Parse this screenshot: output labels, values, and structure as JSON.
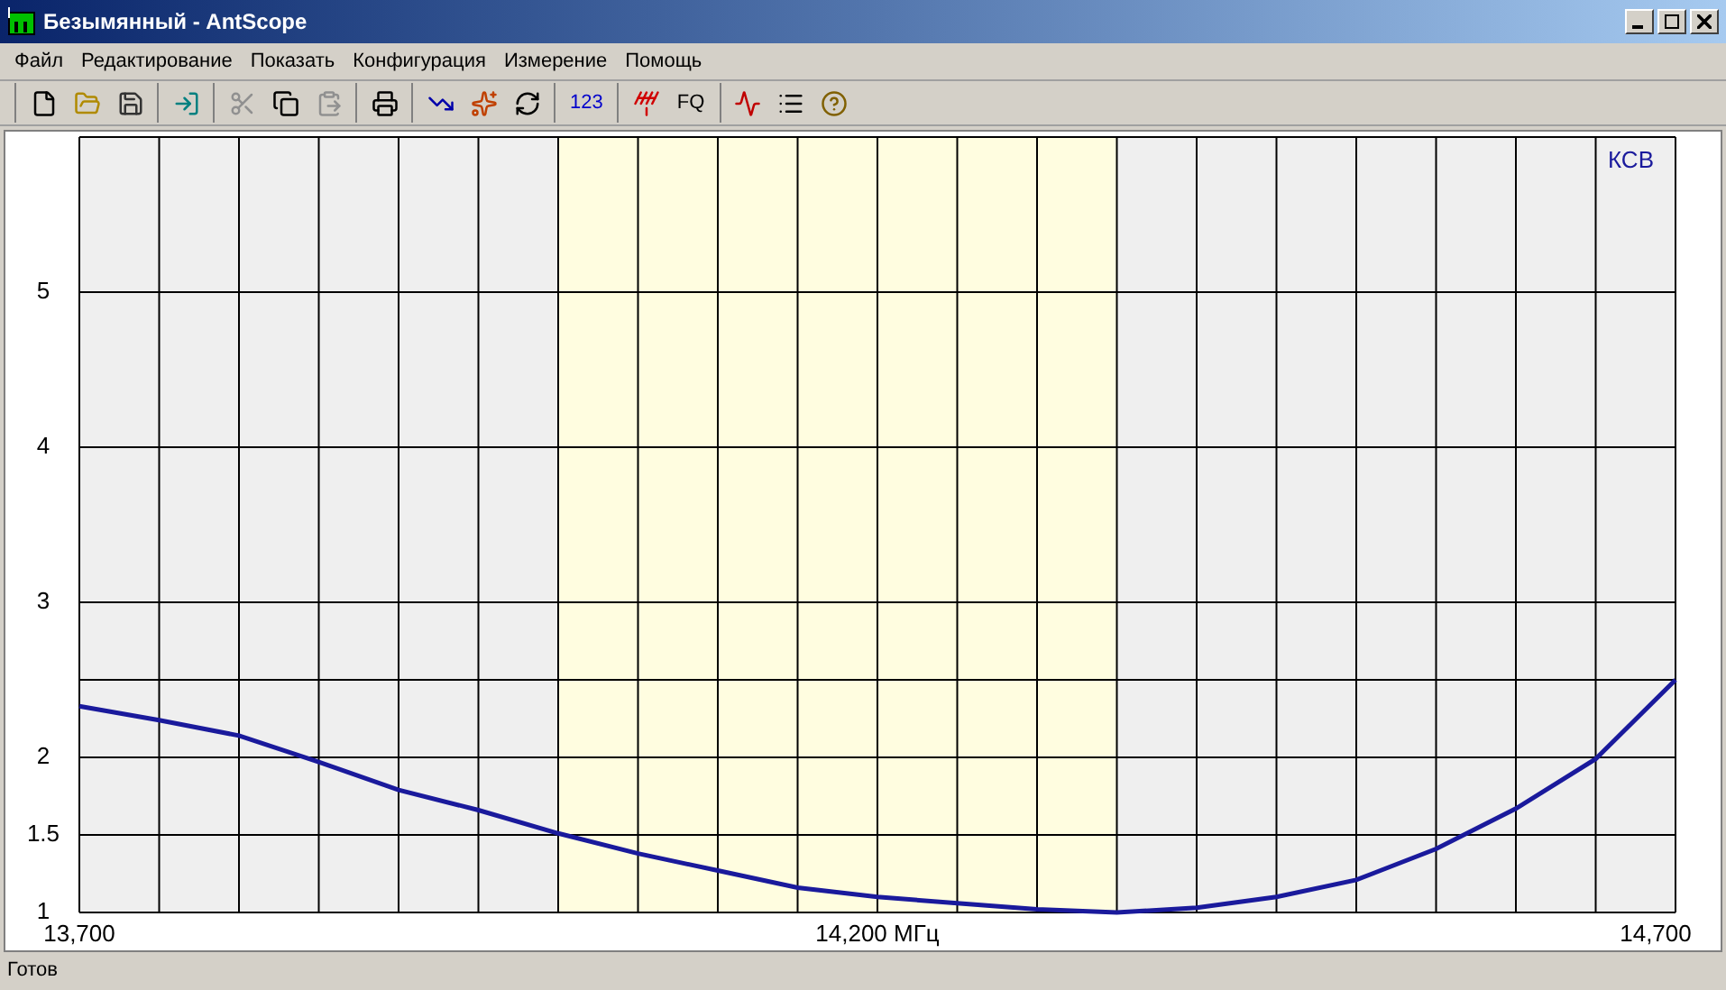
{
  "window": {
    "title": "Безымянный - AntScope"
  },
  "menu": [
    "Файл",
    "Редактирование",
    "Показать",
    "Конфигурация",
    "Измерение",
    "Помощь"
  ],
  "toolbar": [
    [
      {
        "kind": "icon",
        "disabled": false
      },
      {
        "kind": "icon",
        "disabled": false
      },
      {
        "kind": "icon",
        "disabled": false
      }
    ],
    [
      {
        "kind": "icon",
        "disabled": false
      }
    ],
    [
      {
        "kind": "icon",
        "disabled": true
      },
      {
        "kind": "icon",
        "disabled": false
      },
      {
        "kind": "icon",
        "disabled": true
      }
    ],
    [
      {
        "kind": "icon",
        "disabled": false
      }
    ],
    [
      {
        "kind": "icon",
        "disabled": false
      },
      {
        "kind": "icon",
        "disabled": false
      },
      {
        "kind": "icon",
        "disabled": false
      }
    ],
    [
      {
        "kind": "text",
        "label": "123",
        "disabled": false
      }
    ],
    [
      {
        "kind": "icon",
        "disabled": false
      },
      {
        "kind": "text",
        "label": "FQ",
        "disabled": false
      }
    ],
    [
      {
        "kind": "icon",
        "disabled": false
      },
      {
        "kind": "icon",
        "disabled": false
      },
      {
        "kind": "icon",
        "disabled": false
      }
    ]
  ],
  "chart": {
    "chart_data": {
      "type": "line",
      "xlim": [
        13700,
        14700
      ],
      "ylim": [
        1,
        6
      ],
      "xticks": [
        {
          "value": 13700,
          "label": "13,700"
        },
        {
          "value": 14200,
          "label": "14,200 МГц"
        },
        {
          "value": 14700,
          "label": "14,700"
        }
      ],
      "yticks": [
        {
          "value": 1,
          "label": "1"
        },
        {
          "value": 1.5,
          "label": "1.5"
        },
        {
          "value": 2,
          "label": "2"
        },
        {
          "value": 3,
          "label": "3"
        },
        {
          "value": 4,
          "label": "4"
        },
        {
          "value": 5,
          "label": "5"
        }
      ],
      "x": [
        13700,
        13750,
        13800,
        13850,
        13900,
        13950,
        14000,
        14050,
        14100,
        14150,
        14200,
        14250,
        14300,
        14350,
        14400,
        14450,
        14500,
        14550,
        14600,
        14650,
        14700
      ],
      "series": [
        {
          "name": "КСВ",
          "color": "#1a1a9c",
          "values": [
            2.33,
            2.24,
            2.14,
            1.97,
            1.79,
            1.66,
            1.51,
            1.38,
            1.27,
            1.16,
            1.1,
            1.06,
            1.02,
            1.0,
            1.03,
            1.1,
            1.21,
            1.41,
            1.67,
            1.99,
            2.5
          ]
        }
      ],
      "grid": true,
      "bands": [
        {
          "axis": "x",
          "from": 14000,
          "to": 14350
        }
      ]
    }
  },
  "status_bar": "Готов"
}
